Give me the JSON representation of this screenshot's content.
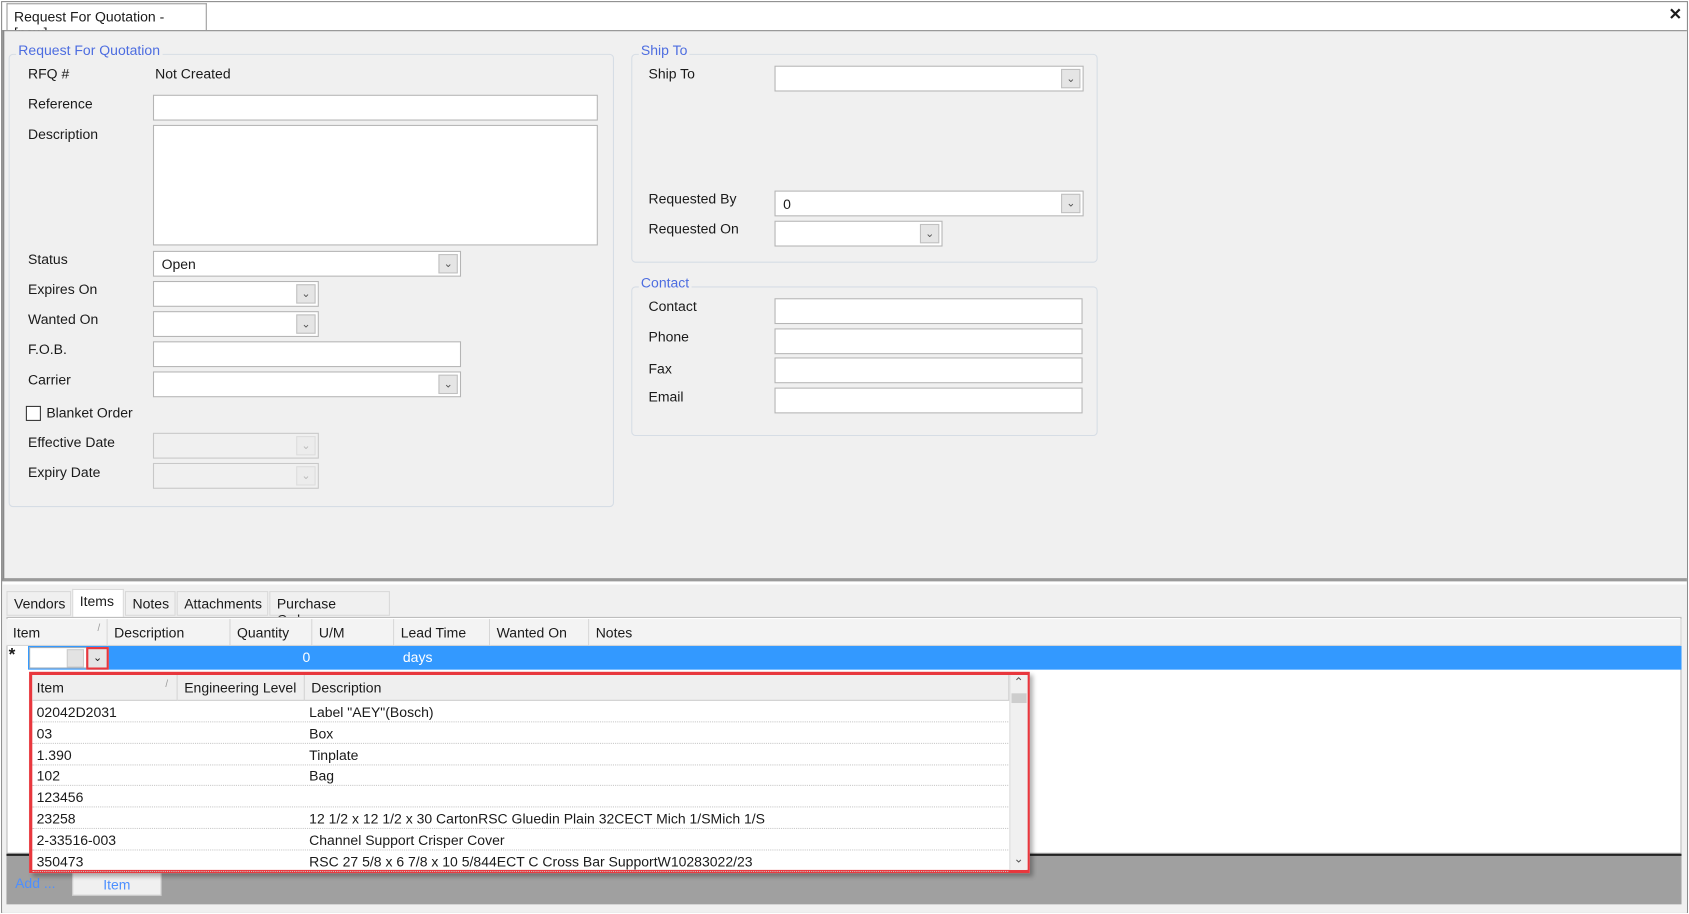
{
  "window": {
    "title": "Request For Quotation - [new]",
    "close_icon": "close-icon"
  },
  "rfq_group": {
    "legend": "Request For Quotation",
    "rfq_label": "RFQ #",
    "rfq_value": "Not Created",
    "reference_label": "Reference",
    "reference_value": "",
    "description_label": "Description",
    "description_value": "",
    "status_label": "Status",
    "status_value": "Open",
    "expires_label": "Expires On",
    "expires_value": "",
    "wanted_label": "Wanted On",
    "wanted_value": "",
    "fob_label": "F.O.B.",
    "fob_value": "",
    "carrier_label": "Carrier",
    "carrier_value": "",
    "blanket_label": "Blanket Order",
    "blanket_checked": false,
    "effective_label": "Effective Date",
    "expiry_label": "Expiry Date"
  },
  "ship_group": {
    "legend": "Ship To",
    "ship_to_label": "Ship To",
    "ship_to_value": "",
    "requested_by_label": "Requested By",
    "requested_by_value": "0",
    "requested_on_label": "Requested On",
    "requested_on_value": ""
  },
  "contact_group": {
    "legend": "Contact",
    "contact_label": "Contact",
    "phone_label": "Phone",
    "fax_label": "Fax",
    "email_label": "Email"
  },
  "tabs": [
    {
      "label": "Vendors"
    },
    {
      "label": "Items",
      "selected": true
    },
    {
      "label": "Notes"
    },
    {
      "label": "Attachments"
    },
    {
      "label": "Purchase Orders"
    }
  ],
  "grid": {
    "columns": [
      "Item",
      "Description",
      "Quantity",
      "U/M",
      "Lead Time",
      "Wanted On",
      "Notes"
    ],
    "new_row": {
      "indicator": "*",
      "item": "",
      "quantity": "0",
      "lead_time": "days"
    }
  },
  "item_dropdown": {
    "columns": [
      "Item",
      "Engineering Level",
      "Description"
    ],
    "rows": [
      {
        "item": "02042D2031",
        "level": "",
        "description": "Label \"AEY\"(Bosch)"
      },
      {
        "item": "03",
        "level": "",
        "description": "Box"
      },
      {
        "item": "1.390",
        "level": "",
        "description": "Tinplate"
      },
      {
        "item": "102",
        "level": "",
        "description": "Bag"
      },
      {
        "item": "123456",
        "level": "",
        "description": ""
      },
      {
        "item": "23258",
        "level": "",
        "description": "12 1/2 x 12 1/2 x 30 CartonRSC Gluedin Plain 32CECT Mich 1/SMich 1/S"
      },
      {
        "item": "2-33516-003",
        "level": "",
        "description": "Channel Support Crisper Cover"
      },
      {
        "item": "350473",
        "level": "",
        "description": "RSC 27 5/8 x 6 7/8 x 10 5/844ECT C Cross Bar SupportW10283022/23"
      }
    ]
  },
  "footer": {
    "add_label": "Add ...",
    "item_button": "Item"
  },
  "colors": {
    "selection": "#3399ff",
    "highlight": "#e8373d",
    "legend": "#4d6de0"
  }
}
